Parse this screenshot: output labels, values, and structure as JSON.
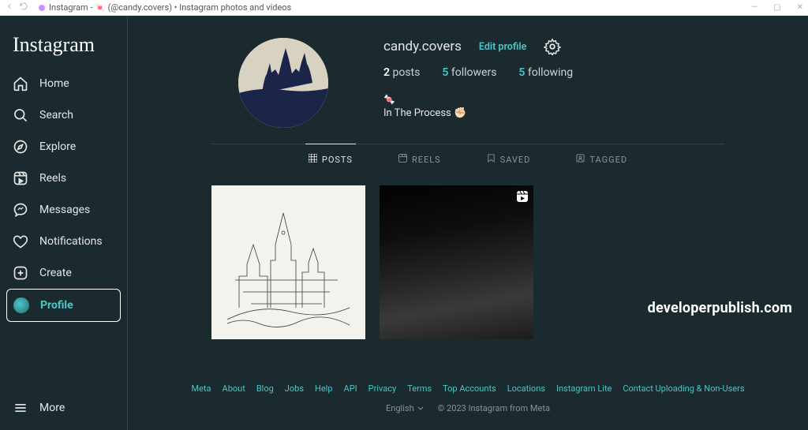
{
  "browser": {
    "tab_title": "Instagram - 🍬 (@candy.covers) • Instagram photos and videos"
  },
  "sidebar": {
    "logo": "Instagram",
    "items": [
      {
        "label": "Home",
        "icon": "home-icon"
      },
      {
        "label": "Search",
        "icon": "search-icon"
      },
      {
        "label": "Explore",
        "icon": "compass-icon"
      },
      {
        "label": "Reels",
        "icon": "reels-icon"
      },
      {
        "label": "Messages",
        "icon": "messenger-icon"
      },
      {
        "label": "Notifications",
        "icon": "heart-icon"
      },
      {
        "label": "Create",
        "icon": "plus-icon"
      },
      {
        "label": "Profile",
        "icon": "avatar-icon"
      }
    ],
    "more": "More"
  },
  "profile": {
    "username": "candy.covers",
    "edit_label": "Edit profile",
    "stats": {
      "posts_count": "2",
      "posts_label": "posts",
      "followers_count": "5",
      "followers_label": "followers",
      "following_count": "5",
      "following_label": "following"
    },
    "bio_emoji": "🍬",
    "bio_text": "In The Process ✊🏻"
  },
  "tabs": [
    {
      "label": "POSTS",
      "active": true
    },
    {
      "label": "REELS",
      "active": false
    },
    {
      "label": "SAVED",
      "active": false
    },
    {
      "label": "TAGGED",
      "active": false
    }
  ],
  "watermark": "developerpublish.com",
  "footer": {
    "links": [
      "Meta",
      "About",
      "Blog",
      "Jobs",
      "Help",
      "API",
      "Privacy",
      "Terms",
      "Top Accounts",
      "Locations",
      "Instagram Lite",
      "Contact Uploading & Non-Users"
    ],
    "language": "English",
    "copyright": "© 2023 Instagram from Meta"
  },
  "colors": {
    "accent": "#4bc5c7",
    "bg": "#1a2a2e"
  }
}
